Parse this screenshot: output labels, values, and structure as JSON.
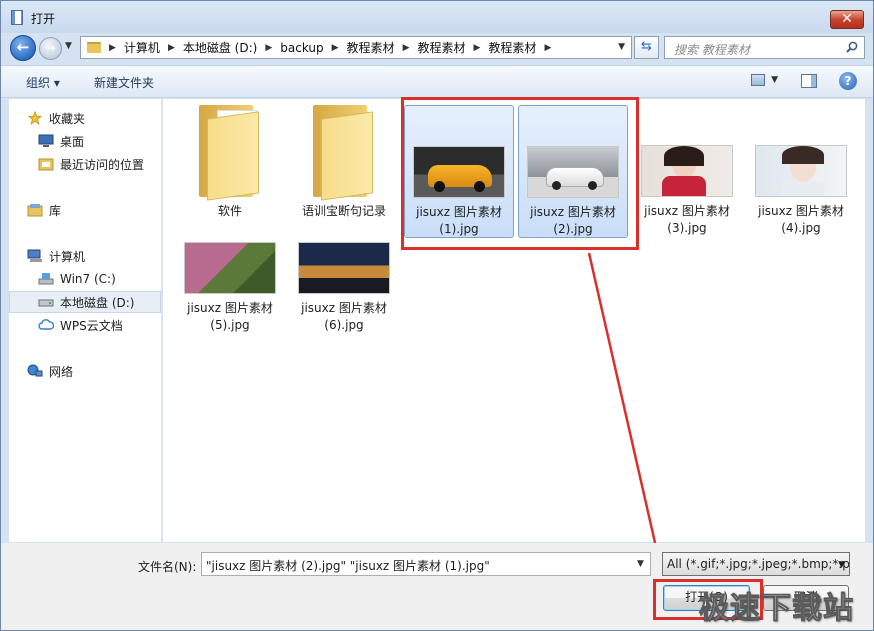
{
  "window": {
    "title": "打开"
  },
  "address": {
    "segments": [
      "计算机",
      "本地磁盘 (D:)",
      "backup",
      "教程素材",
      "教程素材",
      "教程素材"
    ]
  },
  "search": {
    "placeholder": "搜索 教程素材"
  },
  "toolbar": {
    "organize_label": "组织 ▾",
    "new_folder_label": "新建文件夹"
  },
  "sidebar": {
    "favorites": {
      "label": "收藏夹",
      "items": [
        "桌面",
        "最近访问的位置"
      ]
    },
    "library": {
      "label": "库"
    },
    "computer": {
      "label": "计算机",
      "items": [
        "Win7 (C:)",
        "本地磁盘 (D:)",
        "WPS云文档"
      ]
    },
    "network": {
      "label": "网络"
    }
  },
  "files": [
    {
      "name": "软件",
      "kind": "folder"
    },
    {
      "name": "语训宝断句记录",
      "kind": "folder"
    },
    {
      "name": "jisuxz 图片素材 (1).jpg",
      "kind": "image",
      "selected": true
    },
    {
      "name": "jisuxz 图片素材 (2).jpg",
      "kind": "image",
      "selected": true
    },
    {
      "name": "jisuxz 图片素材 (3).jpg",
      "kind": "image",
      "selected": false
    },
    {
      "name": "jisuxz 图片素材 (4).jpg",
      "kind": "image",
      "selected": false
    },
    {
      "name": "jisuxz 图片素材 (5).jpg",
      "kind": "image",
      "selected": false
    },
    {
      "name": "jisuxz 图片素材 (6).jpg",
      "kind": "image",
      "selected": false
    }
  ],
  "bottom": {
    "filename_label": "文件名(N):",
    "filename_value": "\"jisuxz 图片素材 (2).jpg\" \"jisuxz 图片素材 (1).jpg\"",
    "filetype_value": "All (*.gif;*.jpg;*.jpeg;*.bmp;*.p",
    "open_label": "打开(O)",
    "cancel_label": "取消"
  },
  "watermark": "极速下载站",
  "colors": {
    "annotation": "#d9302c",
    "accent": "#2f6cc4",
    "selection": "#c9def7"
  }
}
